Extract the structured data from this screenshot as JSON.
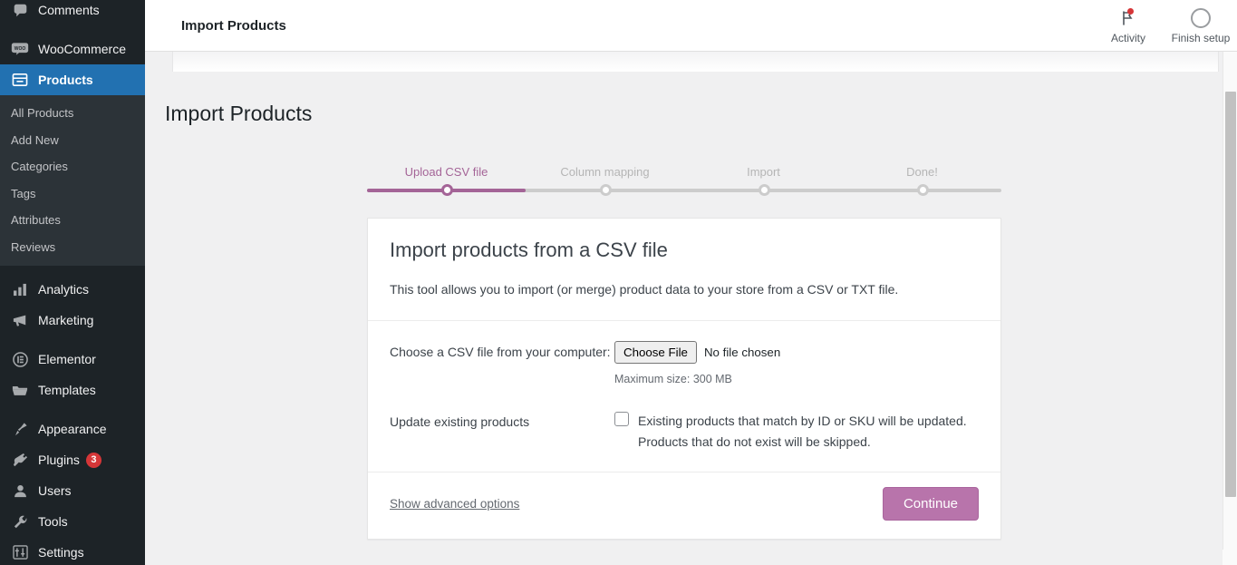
{
  "sidebar": {
    "items": [
      {
        "label": "Comments",
        "icon": "comments-icon",
        "current": false
      },
      {
        "label": "WooCommerce",
        "icon": "woocommerce-icon",
        "current": false
      },
      {
        "label": "Products",
        "icon": "products-icon",
        "current": true
      }
    ],
    "submenu": [
      {
        "label": "All Products"
      },
      {
        "label": "Add New"
      },
      {
        "label": "Categories"
      },
      {
        "label": "Tags"
      },
      {
        "label": "Attributes"
      },
      {
        "label": "Reviews"
      }
    ],
    "items2": [
      {
        "label": "Analytics",
        "icon": "analytics-icon"
      },
      {
        "label": "Marketing",
        "icon": "megaphone-icon"
      }
    ],
    "items3": [
      {
        "label": "Elementor",
        "icon": "elementor-icon"
      },
      {
        "label": "Templates",
        "icon": "folder-icon"
      }
    ],
    "items4": [
      {
        "label": "Appearance",
        "icon": "paintbrush-icon",
        "badge": ""
      },
      {
        "label": "Plugins",
        "icon": "plug-icon",
        "badge": "3"
      },
      {
        "label": "Users",
        "icon": "user-icon",
        "badge": ""
      },
      {
        "label": "Tools",
        "icon": "wrench-icon",
        "badge": ""
      },
      {
        "label": "Settings",
        "icon": "sliders-icon",
        "badge": ""
      }
    ]
  },
  "topbar": {
    "title": "Import Products",
    "actions": [
      {
        "label": "Activity",
        "icon": "flag-icon",
        "has_dot": true
      },
      {
        "label": "Finish setup",
        "icon": "progress-ring-icon",
        "has_dot": false
      }
    ]
  },
  "page": {
    "title": "Import Products"
  },
  "stepper": {
    "steps": [
      {
        "label": "Upload CSV file",
        "active": true
      },
      {
        "label": "Column mapping",
        "active": false
      },
      {
        "label": "Import",
        "active": false
      },
      {
        "label": "Done!",
        "active": false
      }
    ],
    "active_color": "#a46497",
    "inactive_color": "#cccccc"
  },
  "card": {
    "heading": "Import products from a CSV file",
    "description": "This tool allows you to import (or merge) product data to your store from a CSV or TXT file.",
    "file_row": {
      "label": "Choose a CSV file from your computer:",
      "button_label": "Choose File",
      "file_status": "No file chosen",
      "hint": "Maximum size: 300 MB"
    },
    "update_row": {
      "label": "Update existing products",
      "checkbox_checked": false,
      "description_line1": "Existing products that match by ID or SKU will be updated.",
      "description_line2": "Products that do not exist will be skipped."
    },
    "footer": {
      "advanced_link": "Show advanced options",
      "continue_label": "Continue",
      "continue_color": "#b874ab"
    }
  }
}
